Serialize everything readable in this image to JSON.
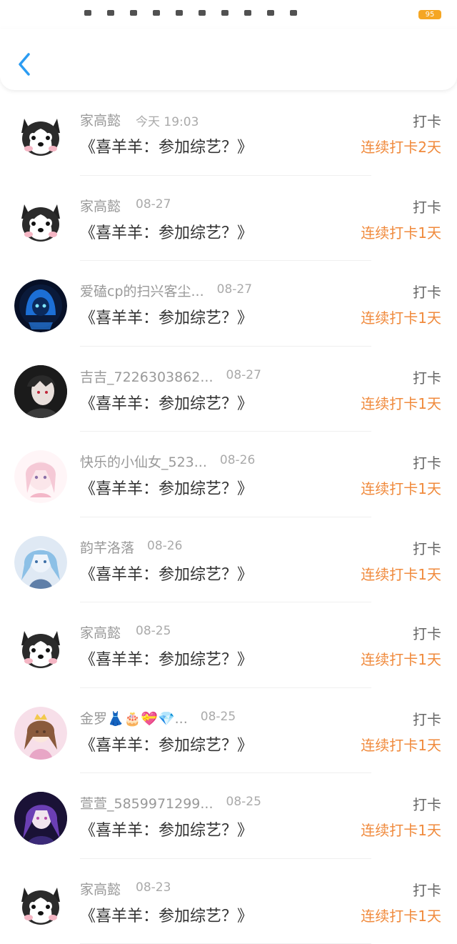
{
  "status_bar": {
    "battery": "95"
  },
  "header": {
    "back_icon": "chevron-left-icon",
    "accent_color": "#2b9cf2"
  },
  "colors": {
    "streak": "#f08a3c",
    "battery": "#f5a623"
  },
  "items": [
    {
      "name": "家高懿",
      "date": "今天 19:03",
      "title": "《喜羊羊：参加综艺？》",
      "action": "打卡",
      "streak": "连续打卡2天",
      "avatar": "husky"
    },
    {
      "name": "家高懿",
      "date": "08-27",
      "title": "《喜羊羊：参加综艺？》",
      "action": "打卡",
      "streak": "连续打卡1天",
      "avatar": "husky"
    },
    {
      "name": "爱磕cp的扫兴客尘...",
      "date": "08-27",
      "title": "《喜羊羊：参加综艺？》",
      "action": "打卡",
      "streak": "连续打卡1天",
      "avatar": "blue-hood"
    },
    {
      "name": "吉吉_7226303862...",
      "date": "08-27",
      "title": "《喜羊羊：参加综艺？》",
      "action": "打卡",
      "streak": "连续打卡1天",
      "avatar": "dark-girl"
    },
    {
      "name": "快乐的小仙女_523...",
      "date": "08-26",
      "title": "《喜羊羊：参加综艺？》",
      "action": "打卡",
      "streak": "连续打卡1天",
      "avatar": "pink-girl"
    },
    {
      "name": "韵芊洛落",
      "date": "08-26",
      "title": "《喜羊羊：参加综艺？》",
      "action": "打卡",
      "streak": "连续打卡1天",
      "avatar": "blue-girl"
    },
    {
      "name": "家高懿",
      "date": "08-25",
      "title": "《喜羊羊：参加综艺？》",
      "action": "打卡",
      "streak": "连续打卡1天",
      "avatar": "husky"
    },
    {
      "name": "金罗👗🎂💝💎...",
      "date": "08-25",
      "title": "《喜羊羊：参加综艺？》",
      "action": "打卡",
      "streak": "连续打卡1天",
      "avatar": "princess"
    },
    {
      "name": "萱萱_5859971299...",
      "date": "08-25",
      "title": "《喜羊羊：参加综艺？》",
      "action": "打卡",
      "streak": "连续打卡1天",
      "avatar": "purple-girl"
    },
    {
      "name": "家高懿",
      "date": "08-23",
      "title": "《喜羊羊：参加综艺？》",
      "action": "打卡",
      "streak": "连续打卡1天",
      "avatar": "husky"
    }
  ]
}
